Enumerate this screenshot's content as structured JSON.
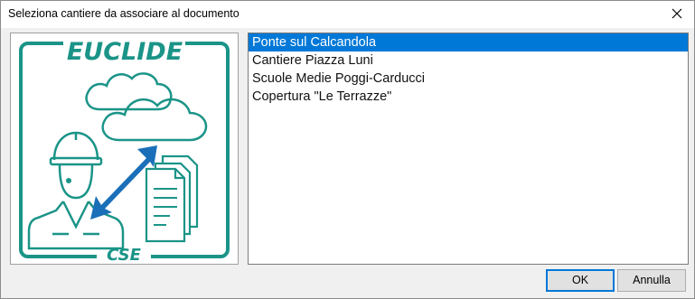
{
  "window": {
    "title": "Seleziona cantiere da associare al documento",
    "close_icon": "close-icon"
  },
  "logo": {
    "brand_text": "EUCLIDE",
    "sub_text": "CSE",
    "brand_color": "#1b9488",
    "arrow_color": "#1a6fb8"
  },
  "list": {
    "items": [
      {
        "label": "Ponte sul Calcandola",
        "selected": true
      },
      {
        "label": "Cantiere Piazza Luni",
        "selected": false
      },
      {
        "label": "Scuole Medie Poggi-Carducci",
        "selected": false
      },
      {
        "label": "Copertura \"Le Terrazze\"",
        "selected": false
      }
    ],
    "selection_color": "#0078d7"
  },
  "buttons": {
    "ok_label": "OK",
    "cancel_label": "Annulla"
  }
}
